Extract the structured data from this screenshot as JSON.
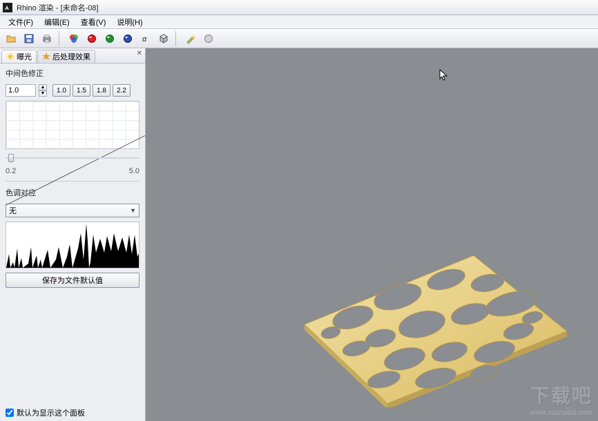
{
  "title": "Rhino 渲染 - [未命名-08]",
  "menu": {
    "file": "文件(F)",
    "edit": "编辑(E)",
    "view": "查看(V)",
    "help": "说明(H)"
  },
  "tabs": {
    "exposure": "曝光",
    "postfx": "后处理效果"
  },
  "midtone": {
    "label": "中间色修正",
    "value": "1.0",
    "presets": {
      "p10": "1.0",
      "p15": "1.5",
      "p18": "1.8",
      "p22": "2.2"
    }
  },
  "slider": {
    "min": "0.2",
    "max": "5.0"
  },
  "tonemap": {
    "label": "色调对应",
    "selected": "无"
  },
  "save_btn": "保存为文件默认值",
  "bottom_check": "默认为显示这个面板",
  "watermark": {
    "brand": "下载吧",
    "url": "www.xiazaiba.com"
  }
}
